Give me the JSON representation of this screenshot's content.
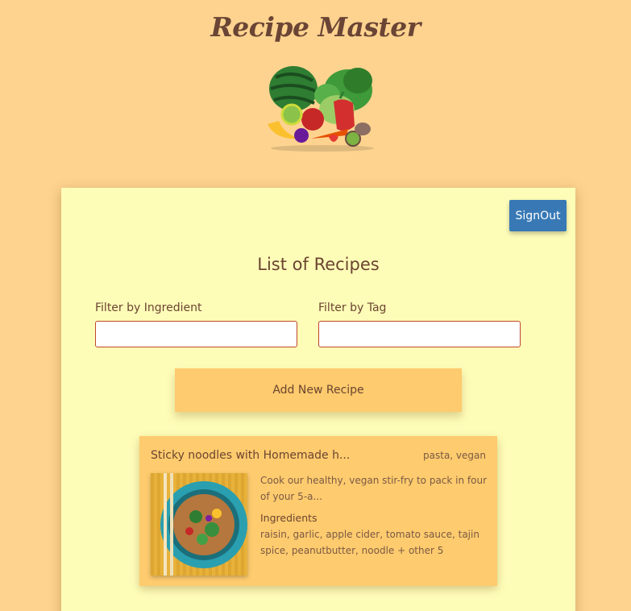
{
  "header": {
    "app_title": "Recipe Master"
  },
  "main": {
    "signout_label": "SignOut",
    "list_heading": "List of Recipes",
    "filters": {
      "ingredient_label": "Filter by Ingredient",
      "ingredient_value": "",
      "tag_label": "Filter by Tag",
      "tag_value": ""
    },
    "add_button_label": "Add New Recipe",
    "recipes": [
      {
        "title": "Sticky noodles with Homemade h...",
        "tags": "pasta, vegan",
        "description": "Cook our healthy, vegan stir-fry to pack in four of your 5-a...",
        "ingredients_heading": "Ingredients",
        "ingredients": "raisin, garlic, apple cider, tomato sauce, tajin spice, peanutbutter, noodle + other 5"
      }
    ]
  },
  "colors": {
    "page_background": "#FDD38F",
    "card_background": "#FEFDB8",
    "accent_button": "#FECB6E",
    "signout_button": "#3879B5",
    "text": "#6b4430"
  }
}
